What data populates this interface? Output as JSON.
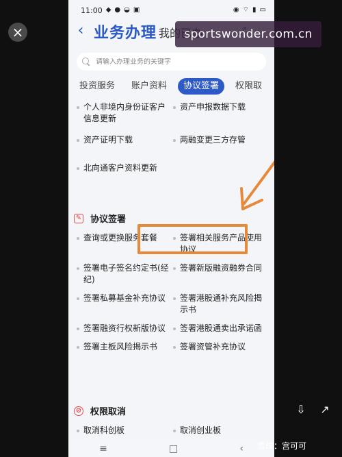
{
  "status": {
    "time": "11:00",
    "left_icons": [
      "notification-icon",
      "shield-icon",
      "chat-icon",
      "image-icon"
    ],
    "right_icons": [
      "eye-icon",
      "wifi-icon",
      "signal-icon",
      "battery-icon"
    ]
  },
  "header": {
    "back_label": "‹",
    "title": "业务办理",
    "partial_title": "我的已办"
  },
  "search": {
    "placeholder": "请输入办理业务的关键字"
  },
  "tabs": [
    {
      "label": "投资服务"
    },
    {
      "label": "账户资料"
    },
    {
      "label": "协议签署"
    },
    {
      "label": "权限取"
    }
  ],
  "account_items": [
    {
      "label": "个人非境内身份证客户信息更新"
    },
    {
      "label": "资产申报数据下载"
    },
    {
      "label": "资产证明下载"
    },
    {
      "label": "两融变更三方存管"
    },
    {
      "label": "北向通客户资料更新"
    }
  ],
  "agreements": {
    "title": "协议签署",
    "items": [
      {
        "label": "查询或更换服务套餐"
      },
      {
        "label": "签署相关服务产品使用协议"
      },
      {
        "label": "签署电子签名约定书(经纪)"
      },
      {
        "label": "签署新版融资融券合同"
      },
      {
        "label": "签署私募基金补充协议"
      },
      {
        "label": "签署港股通补充风险揭示书"
      },
      {
        "label": "签署融资行权新版协议"
      },
      {
        "label": "签署港股通卖出承诺函"
      },
      {
        "label": "签署主板风险揭示书"
      },
      {
        "label": "签署资管补充协议"
      }
    ]
  },
  "permissions": {
    "title": "权限取消",
    "items": [
      {
        "label": "取消科创板"
      },
      {
        "label": "取消创业板"
      }
    ]
  },
  "overlay": {
    "watermark": "sportswonder.com.cn",
    "footer": "雪球：宫可可"
  },
  "colors": {
    "accent": "#2d5ac7",
    "highlight": "#e7893a",
    "section_icon": "#e04848"
  }
}
